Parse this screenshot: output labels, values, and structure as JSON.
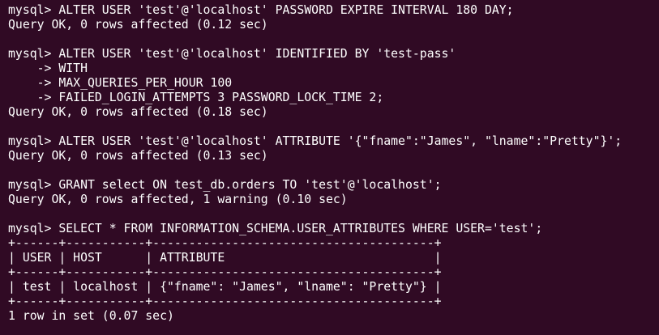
{
  "terminal": {
    "background": "#300a24",
    "foreground": "#ffffff",
    "lines": [
      "mysql> ALTER USER 'test'@'localhost' PASSWORD EXPIRE INTERVAL 180 DAY;",
      "Query OK, 0 rows affected (0.12 sec)",
      "",
      "mysql> ALTER USER 'test'@'localhost' IDENTIFIED BY 'test-pass'",
      "    -> WITH",
      "    -> MAX_QUERIES_PER_HOUR 100",
      "    -> FAILED_LOGIN_ATTEMPTS 3 PASSWORD_LOCK_TIME 2;",
      "Query OK, 0 rows affected (0.18 sec)",
      "",
      "mysql> ALTER USER 'test'@'localhost' ATTRIBUTE '{\"fname\":\"James\", \"lname\":\"Pretty\"}';",
      "Query OK, 0 rows affected (0.13 sec)",
      "",
      "mysql> GRANT select ON test_db.orders TO 'test'@'localhost';",
      "Query OK, 0 rows affected, 1 warning (0.10 sec)",
      "",
      "mysql> SELECT * FROM INFORMATION_SCHEMA.USER_ATTRIBUTES WHERE USER='test';",
      "+------+-----------+---------------------------------------+",
      "| USER | HOST      | ATTRIBUTE                             |",
      "+------+-----------+---------------------------------------+",
      "| test | localhost | {\"fname\": \"James\", \"lname\": \"Pretty\"} |",
      "+------+-----------+---------------------------------------+",
      "1 row in set (0.07 sec)"
    ]
  }
}
